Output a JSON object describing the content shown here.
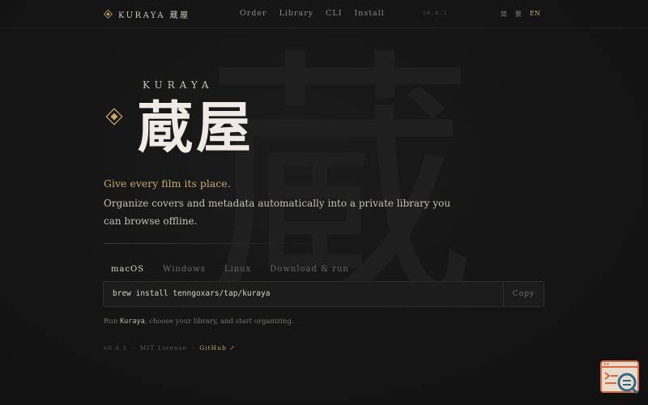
{
  "header": {
    "brand": "KURAYA 蔵屋",
    "nav": [
      "Order",
      "Library",
      "CLI",
      "Install"
    ],
    "version": "v0.6.1",
    "languages": [
      "简",
      "繁",
      "EN"
    ],
    "active_language": "EN"
  },
  "hero": {
    "watermark": "蔵",
    "eyebrow": "KURAYA",
    "title": "蔵屋",
    "tagline": "Give every film its place.",
    "description": "Organize covers and metadata automatically into a private library you can browse offline."
  },
  "install": {
    "tabs": [
      "macOS",
      "Windows",
      "Linux",
      "Download & run"
    ],
    "active_tab": "macOS",
    "command": "brew install tenngoxars/tap/kuraya",
    "copy_label": "Copy",
    "hint_prefix": "Run ",
    "hint_app": "Kuraya",
    "hint_suffix": ", choose your library, and start organizing."
  },
  "footer": {
    "version": "v0.6.1",
    "sep1": "·",
    "license": "MIT License",
    "sep2": "·",
    "github": "GitHub ↗"
  },
  "colors": {
    "accent": "#c9a86a",
    "background": "#141414"
  },
  "icons": {
    "brand": "diamond-emblem-icon",
    "fab": "terminal-search-icon"
  }
}
